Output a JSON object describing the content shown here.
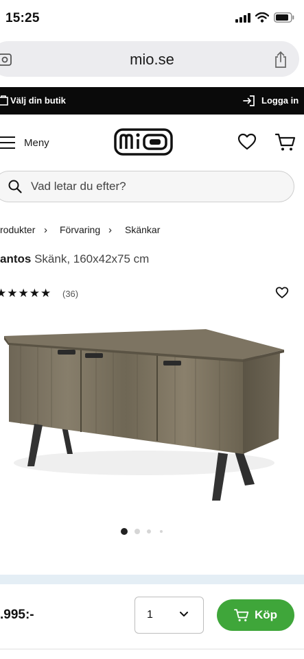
{
  "status_bar": {
    "time": "15:25"
  },
  "browser": {
    "url": "mio.se"
  },
  "top_bar": {
    "store_label": "Välj din butik",
    "login_label": "Logga in"
  },
  "header": {
    "menu_label": "Meny",
    "logo_text": "mio"
  },
  "search": {
    "placeholder": "Vad letar du efter?"
  },
  "breadcrumb": {
    "items": [
      "rodukter",
      "Förvaring",
      "Skänkar"
    ]
  },
  "product": {
    "name": "antos",
    "description": "Skänk, 160x42x75 cm",
    "rating": 4.5,
    "rating_stars": "★★★★★",
    "review_count": "(36)",
    "image_count": 4,
    "active_image": 0,
    "price": ".995:-",
    "quantity": "1",
    "buy_label": "Köp"
  },
  "colors": {
    "accent_green": "#3fa63a",
    "top_bar_bg": "#0a0a0a"
  }
}
